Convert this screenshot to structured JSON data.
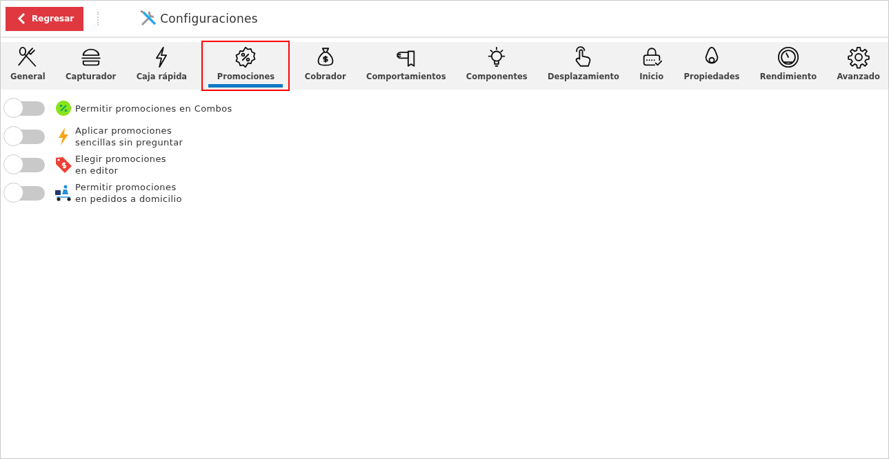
{
  "header": {
    "back_button": "Regresar",
    "title": "Configuraciones"
  },
  "tabs": [
    {
      "label": "General",
      "selected": false
    },
    {
      "label": "Capturador",
      "selected": false
    },
    {
      "label": "Caja rápida",
      "selected": false
    },
    {
      "label": "Promociones",
      "selected": true
    },
    {
      "label": "Cobrador",
      "selected": false
    },
    {
      "label": "Comportamientos",
      "selected": false
    },
    {
      "label": "Componentes",
      "selected": false
    },
    {
      "label": "Desplazamiento",
      "selected": false
    },
    {
      "label": "Inicio",
      "selected": false
    },
    {
      "label": "Propiedades",
      "selected": false
    },
    {
      "label": "Rendimiento",
      "selected": false
    },
    {
      "label": "Avanzado",
      "selected": false
    }
  ],
  "settings": [
    {
      "lines": [
        "Permitir promociones en Combos"
      ],
      "on": false
    },
    {
      "lines": [
        "Aplicar promociones",
        "sencillas sin preguntar"
      ],
      "on": false
    },
    {
      "lines": [
        "Elegir promociones",
        "en editor"
      ],
      "on": false
    },
    {
      "lines": [
        "Permitir promociones",
        "en pedidos a domicilio"
      ],
      "on": false
    }
  ]
}
